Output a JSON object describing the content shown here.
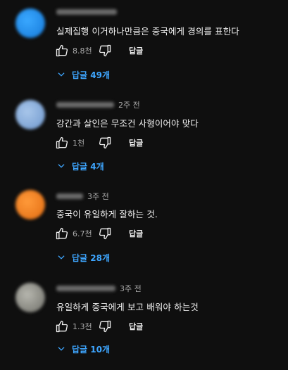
{
  "colors": {
    "background": "#0f0f0f",
    "text": "#f1f1f1",
    "secondary_text": "#aaaaaa",
    "link_blue": "#3ea6ff"
  },
  "reply_label": "답글",
  "comments": [
    {
      "avatar_color": "#1e90e8",
      "time": "",
      "text": "실제집행  이거하나만큼은  중국에게 경의를 표한다",
      "likes": "8.8천",
      "replies_label": "답글 49개"
    },
    {
      "avatar_color": "#8fb4e0",
      "time": "2주 전",
      "text": "강간과 살인은 무조건 사형이어야 맞다",
      "likes": "1천",
      "replies_label": "답글 4개"
    },
    {
      "avatar_color": "#f07a1a",
      "time": "3주 전",
      "text": "중국이 유일하게 잘하는 것.",
      "likes": "6.7천",
      "replies_label": "답글 28개"
    },
    {
      "avatar_color": "#8a8a82",
      "time": "3주 전",
      "text": "유일하게 중국에게 보고 배워야 하는것",
      "likes": "1.3천",
      "replies_label": "답글 10개"
    }
  ]
}
